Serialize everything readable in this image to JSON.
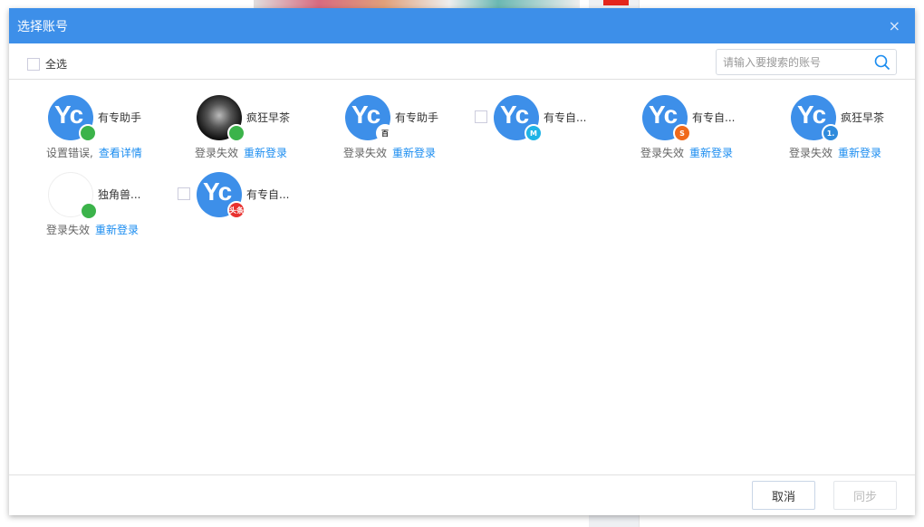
{
  "dialog": {
    "title": "选择账号",
    "close": "×"
  },
  "toolbar": {
    "select_all": "全选",
    "search_placeholder": "请输入要搜索的账号"
  },
  "accounts": [
    {
      "name": "有专助手",
      "platform": "wechat",
      "badge_color": "#3bb34a",
      "badge": "",
      "status": "设置错误,",
      "action": "查看详情",
      "checkbox": false
    },
    {
      "name": "疯狂早茶",
      "platform": "wechat",
      "badge_color": "#3bb34a",
      "badge": "",
      "status": "登录失效",
      "action": "重新登录",
      "checkbox": false
    },
    {
      "name": "有专助手",
      "platform": "baijiahao",
      "badge_color": "#ffffff",
      "badge": "百",
      "status": "登录失效",
      "action": "重新登录",
      "checkbox": false
    },
    {
      "name": "有专自...",
      "platform": "dayu",
      "badge_color": "#1fb3e6",
      "badge": "M",
      "status": "",
      "action": "",
      "checkbox": true
    },
    {
      "name": "有专自...",
      "platform": "weibo",
      "badge_color": "#f06a1c",
      "badge": "S",
      "status": "登录失效",
      "action": "重新登录",
      "checkbox": false
    },
    {
      "name": "疯狂早茶",
      "platform": "yidian",
      "badge_color": "#2f8bdc",
      "badge": "1.",
      "status": "登录失效",
      "action": "重新登录",
      "checkbox": false
    },
    {
      "name": "独角兽...",
      "platform": "wechat",
      "badge_color": "#3bb34a",
      "badge": "",
      "status": "登录失效",
      "action": "重新登录",
      "checkbox": false
    },
    {
      "name": "有专自...",
      "platform": "toutiao",
      "badge_color": "#e8312f",
      "badge": "头条",
      "status": "",
      "action": "",
      "checkbox": true
    }
  ],
  "footer": {
    "cancel": "取消",
    "sync": "同步"
  }
}
